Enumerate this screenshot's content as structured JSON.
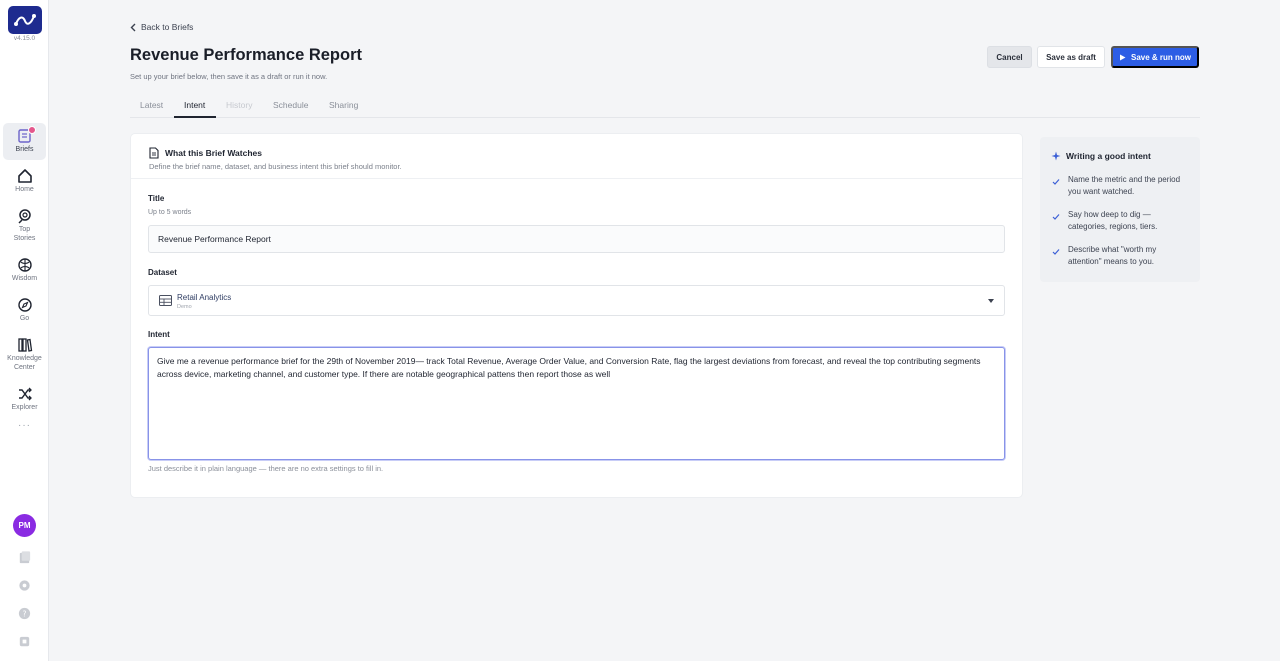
{
  "app": {
    "version": "v4.15.0"
  },
  "sidebar": {
    "items": [
      {
        "label": "Briefs",
        "icon": "briefs-icon"
      },
      {
        "label": "Home",
        "icon": "home-icon"
      },
      {
        "label": "Top Stories",
        "icon": "search-icon"
      },
      {
        "label": "Wisdom",
        "icon": "brain-icon"
      },
      {
        "label": "Go",
        "icon": "compass-icon"
      },
      {
        "label": "Knowledge Center",
        "icon": "library-icon"
      },
      {
        "label": "Explorer",
        "icon": "shuffle-icon"
      }
    ],
    "more": "···",
    "avatar_initials": "PM"
  },
  "header": {
    "back_label": "Back to Briefs",
    "title": "Revenue Performance Report",
    "subtitle": "Set up your brief below, then save it as a draft or run it now.",
    "cancel_label": "Cancel",
    "draft_label": "Save as draft",
    "run_label": "Save & run now"
  },
  "tabs": [
    {
      "label": "Latest",
      "state": "normal"
    },
    {
      "label": "Intent",
      "state": "active"
    },
    {
      "label": "History",
      "state": "disabled"
    },
    {
      "label": "Schedule",
      "state": "normal"
    },
    {
      "label": "Sharing",
      "state": "normal"
    }
  ],
  "card": {
    "title": "What this Brief Watches",
    "subtitle": "Define the brief name, dataset, and business intent this brief should monitor.",
    "title_field": {
      "label": "Title",
      "help": "Up to 5 words",
      "value": "Revenue Performance Report"
    },
    "dataset_field": {
      "label": "Dataset",
      "selected_name": "Retail Analytics",
      "selected_sub": "Demo"
    },
    "intent_field": {
      "label": "Intent",
      "value": "Give me a revenue performance brief for the 29th of November 2019— track Total Revenue, Average Order Value, and Conversion Rate, flag the largest deviations from forecast, and reveal the top contributing segments across device, marketing channel, and customer type. If there are notable geographical pattens then report those as well",
      "help": "Just describe it in plain language — there are no extra settings to fill in."
    }
  },
  "tips": {
    "title": "Writing a good intent",
    "items": [
      "Name the metric and the period you want watched.",
      "Say how deep to dig — categories, regions, tiers.",
      "Describe what \"worth my attention\" means to you."
    ]
  },
  "colors": {
    "accent": "#2c5de5",
    "brand": "#1e2b8f",
    "avatar": "#8a2be2",
    "badge": "#e4578c"
  }
}
